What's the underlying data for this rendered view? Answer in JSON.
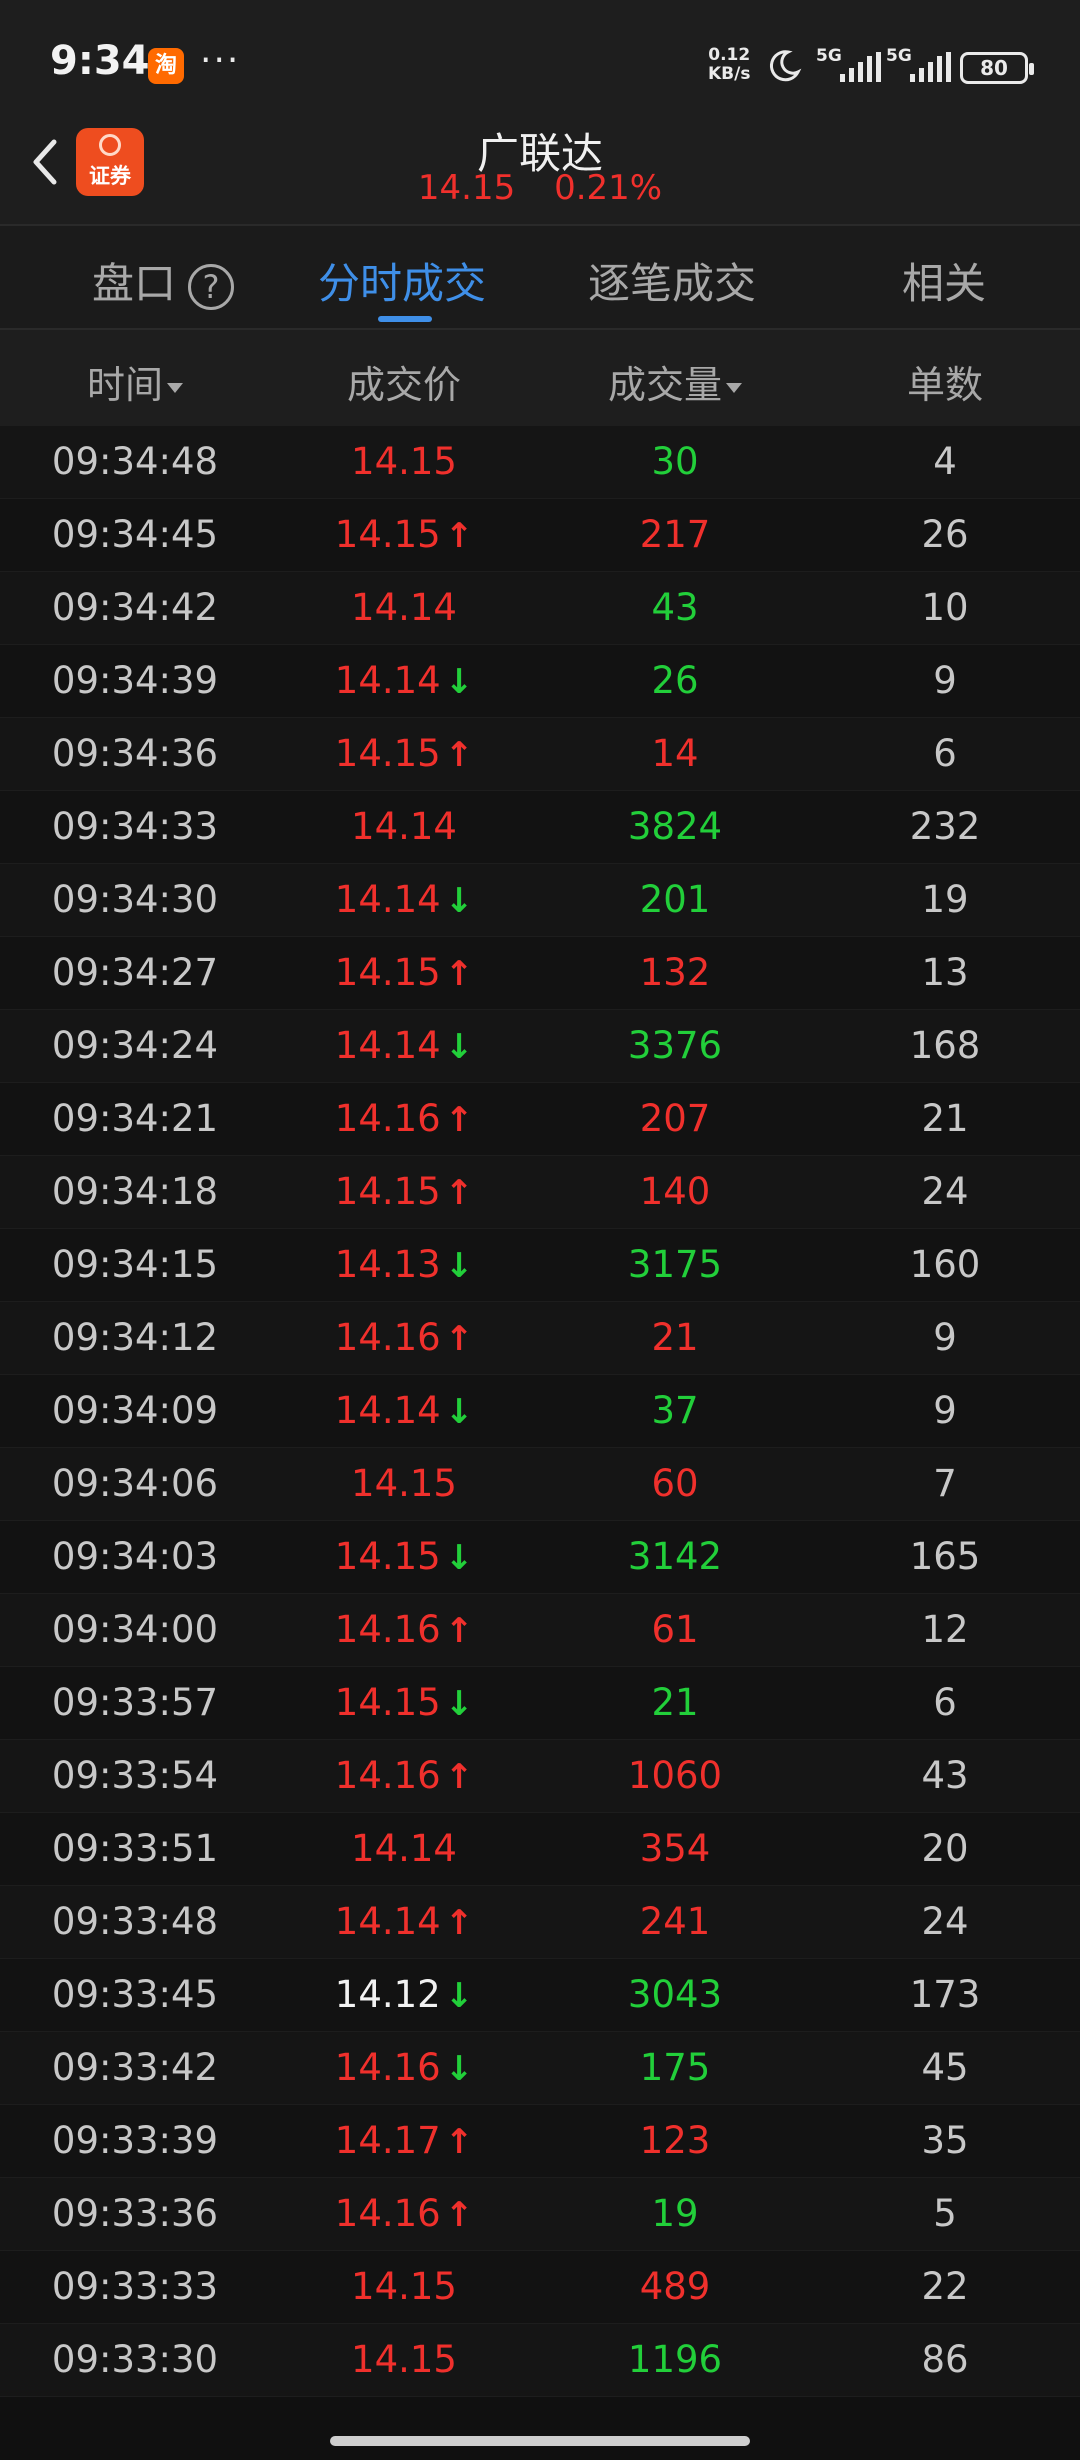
{
  "status_bar": {
    "time": "9:34",
    "app_icon_text": "淘",
    "more": "···",
    "net_speed_value": "0.12",
    "net_speed_unit": "KB/s",
    "signal1_label": "5G",
    "signal2_label": "5G",
    "battery": "80"
  },
  "header": {
    "badge_text": "证券",
    "stock_name": "广联达",
    "price": "14.15",
    "change_pct": "0.21%"
  },
  "tabs": [
    {
      "label": "盘口",
      "active": false
    },
    {
      "label": "分时成交",
      "active": true
    },
    {
      "label": "逐笔成交",
      "active": false
    },
    {
      "label": "相关",
      "active": false
    }
  ],
  "help_icon_glyph": "?",
  "columns": {
    "time": "时间",
    "price": "成交价",
    "volume": "成交量",
    "count": "单数"
  },
  "colors": {
    "red": "#f0302c",
    "green": "#22cf3a",
    "accent": "#3f8fe8"
  },
  "trades": [
    {
      "time": "09:34:48",
      "price": "14.15",
      "price_color": "red",
      "arrow": "",
      "volume": "30",
      "volume_color": "green",
      "count": "4"
    },
    {
      "time": "09:34:45",
      "price": "14.15",
      "price_color": "red",
      "arrow": "up",
      "volume": "217",
      "volume_color": "red",
      "count": "26"
    },
    {
      "time": "09:34:42",
      "price": "14.14",
      "price_color": "red",
      "arrow": "",
      "volume": "43",
      "volume_color": "green",
      "count": "10"
    },
    {
      "time": "09:34:39",
      "price": "14.14",
      "price_color": "red",
      "arrow": "down",
      "volume": "26",
      "volume_color": "green",
      "count": "9"
    },
    {
      "time": "09:34:36",
      "price": "14.15",
      "price_color": "red",
      "arrow": "up",
      "volume": "14",
      "volume_color": "red",
      "count": "6"
    },
    {
      "time": "09:34:33",
      "price": "14.14",
      "price_color": "red",
      "arrow": "",
      "volume": "3824",
      "volume_color": "green",
      "count": "232"
    },
    {
      "time": "09:34:30",
      "price": "14.14",
      "price_color": "red",
      "arrow": "down",
      "volume": "201",
      "volume_color": "green",
      "count": "19"
    },
    {
      "time": "09:34:27",
      "price": "14.15",
      "price_color": "red",
      "arrow": "up",
      "volume": "132",
      "volume_color": "red",
      "count": "13"
    },
    {
      "time": "09:34:24",
      "price": "14.14",
      "price_color": "red",
      "arrow": "down",
      "volume": "3376",
      "volume_color": "green",
      "count": "168"
    },
    {
      "time": "09:34:21",
      "price": "14.16",
      "price_color": "red",
      "arrow": "up",
      "volume": "207",
      "volume_color": "red",
      "count": "21"
    },
    {
      "time": "09:34:18",
      "price": "14.15",
      "price_color": "red",
      "arrow": "up",
      "volume": "140",
      "volume_color": "red",
      "count": "24"
    },
    {
      "time": "09:34:15",
      "price": "14.13",
      "price_color": "red",
      "arrow": "down",
      "volume": "3175",
      "volume_color": "green",
      "count": "160"
    },
    {
      "time": "09:34:12",
      "price": "14.16",
      "price_color": "red",
      "arrow": "up",
      "volume": "21",
      "volume_color": "red",
      "count": "9"
    },
    {
      "time": "09:34:09",
      "price": "14.14",
      "price_color": "red",
      "arrow": "down",
      "volume": "37",
      "volume_color": "green",
      "count": "9"
    },
    {
      "time": "09:34:06",
      "price": "14.15",
      "price_color": "red",
      "arrow": "",
      "volume": "60",
      "volume_color": "red",
      "count": "7"
    },
    {
      "time": "09:34:03",
      "price": "14.15",
      "price_color": "red",
      "arrow": "down",
      "volume": "3142",
      "volume_color": "green",
      "count": "165"
    },
    {
      "time": "09:34:00",
      "price": "14.16",
      "price_color": "red",
      "arrow": "up",
      "volume": "61",
      "volume_color": "red",
      "count": "12"
    },
    {
      "time": "09:33:57",
      "price": "14.15",
      "price_color": "red",
      "arrow": "down",
      "volume": "21",
      "volume_color": "green",
      "count": "6"
    },
    {
      "time": "09:33:54",
      "price": "14.16",
      "price_color": "red",
      "arrow": "up",
      "volume": "1060",
      "volume_color": "red",
      "count": "43"
    },
    {
      "time": "09:33:51",
      "price": "14.14",
      "price_color": "red",
      "arrow": "",
      "volume": "354",
      "volume_color": "red",
      "count": "20"
    },
    {
      "time": "09:33:48",
      "price": "14.14",
      "price_color": "red",
      "arrow": "up",
      "volume": "241",
      "volume_color": "red",
      "count": "24"
    },
    {
      "time": "09:33:45",
      "price": "14.12",
      "price_color": "white",
      "arrow": "down",
      "volume": "3043",
      "volume_color": "green",
      "count": "173"
    },
    {
      "time": "09:33:42",
      "price": "14.16",
      "price_color": "red",
      "arrow": "down",
      "volume": "175",
      "volume_color": "green",
      "count": "45"
    },
    {
      "time": "09:33:39",
      "price": "14.17",
      "price_color": "red",
      "arrow": "up",
      "volume": "123",
      "volume_color": "red",
      "count": "35"
    },
    {
      "time": "09:33:36",
      "price": "14.16",
      "price_color": "red",
      "arrow": "up",
      "volume": "19",
      "volume_color": "green",
      "count": "5"
    },
    {
      "time": "09:33:33",
      "price": "14.15",
      "price_color": "red",
      "arrow": "",
      "volume": "489",
      "volume_color": "red",
      "count": "22"
    },
    {
      "time": "09:33:30",
      "price": "14.15",
      "price_color": "red",
      "arrow": "",
      "volume": "1196",
      "volume_color": "green",
      "count": "86"
    }
  ]
}
